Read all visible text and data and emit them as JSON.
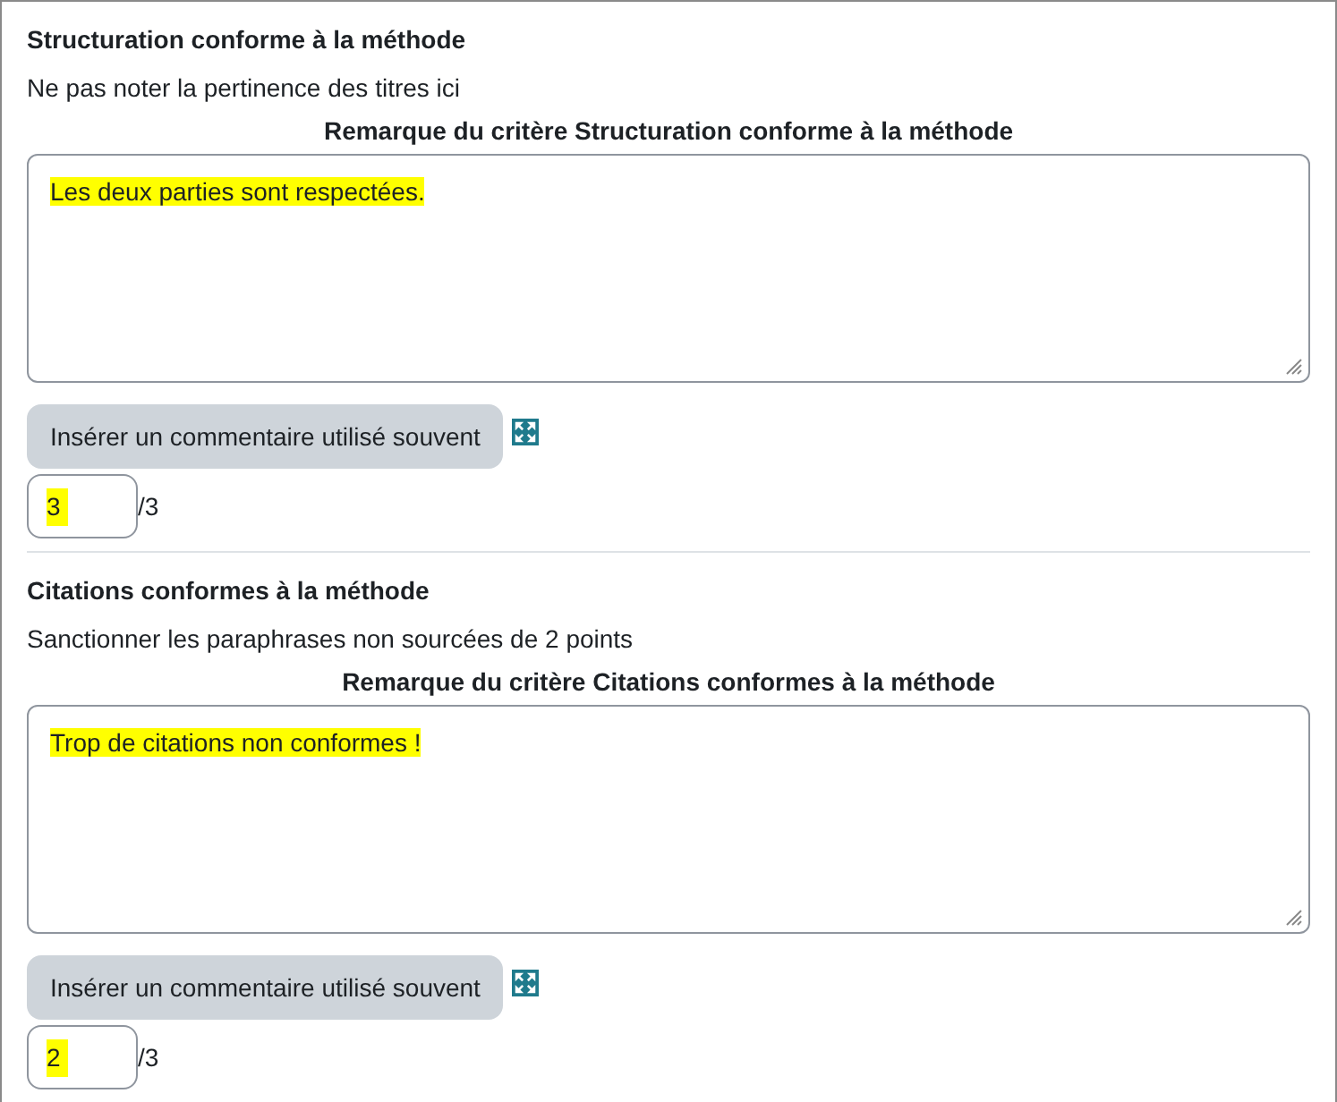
{
  "criteria": [
    {
      "title": "Structuration conforme à la méthode",
      "description": "Ne pas noter la pertinence des titres ici",
      "remark_label": "Remarque du critère Structuration conforme à la méthode",
      "remark": {
        "value": "Les deux parties sont respectées.",
        "highlighted": true
      },
      "button": "Insérer un commentaire utilisé souvent",
      "score": {
        "value": "3",
        "highlighted": true
      },
      "max": "/3"
    },
    {
      "title": "Citations conformes à la méthode",
      "description": "Sanctionner les paraphrases non sourcées de 2 points",
      "remark_label": "Remarque du critère Citations conformes à la méthode",
      "remark": {
        "value": "Trop de citations non conformes !",
        "highlighted": true
      },
      "button": "Insérer un commentaire utilisé souvent",
      "score": {
        "value": "2",
        "highlighted": true
      },
      "max": "/3"
    }
  ]
}
